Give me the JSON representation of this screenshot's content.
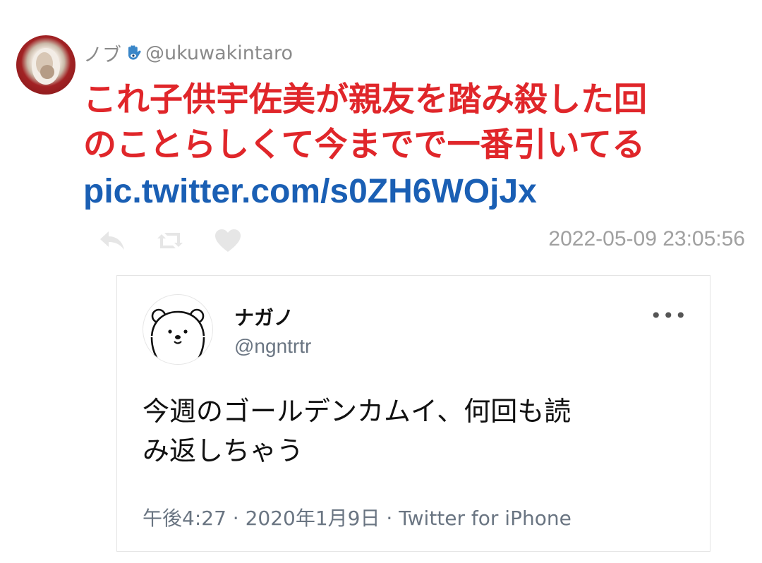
{
  "tweet": {
    "display_name": "ノブ",
    "handle": "@ukuwakintaro",
    "text_line1": "これ子供宇佐美が親友を踏み殺した回",
    "text_line2": "のことらしくて今までで一番引いてる",
    "link": "pic.twitter.com/s0ZH6WOjJx",
    "timestamp": "2022-05-09 23:05:56",
    "icons": {
      "name_badge": "hamsa-hand-icon",
      "reply": "reply-icon",
      "retweet": "retweet-icon",
      "like": "heart-icon"
    },
    "colors": {
      "text": "#e0262a",
      "link": "#1a5fb4",
      "meta": "#a0a0a0"
    }
  },
  "quoted_tweet": {
    "display_name": "ナガノ",
    "handle": "@ngntrtr",
    "more_label": "•••",
    "text_line1": "今週のゴールデンカムイ、何回も読",
    "text_line2": "み返しちゃう",
    "meta": "午後4:27 · 2020年1月9日 · Twitter for iPhone"
  }
}
